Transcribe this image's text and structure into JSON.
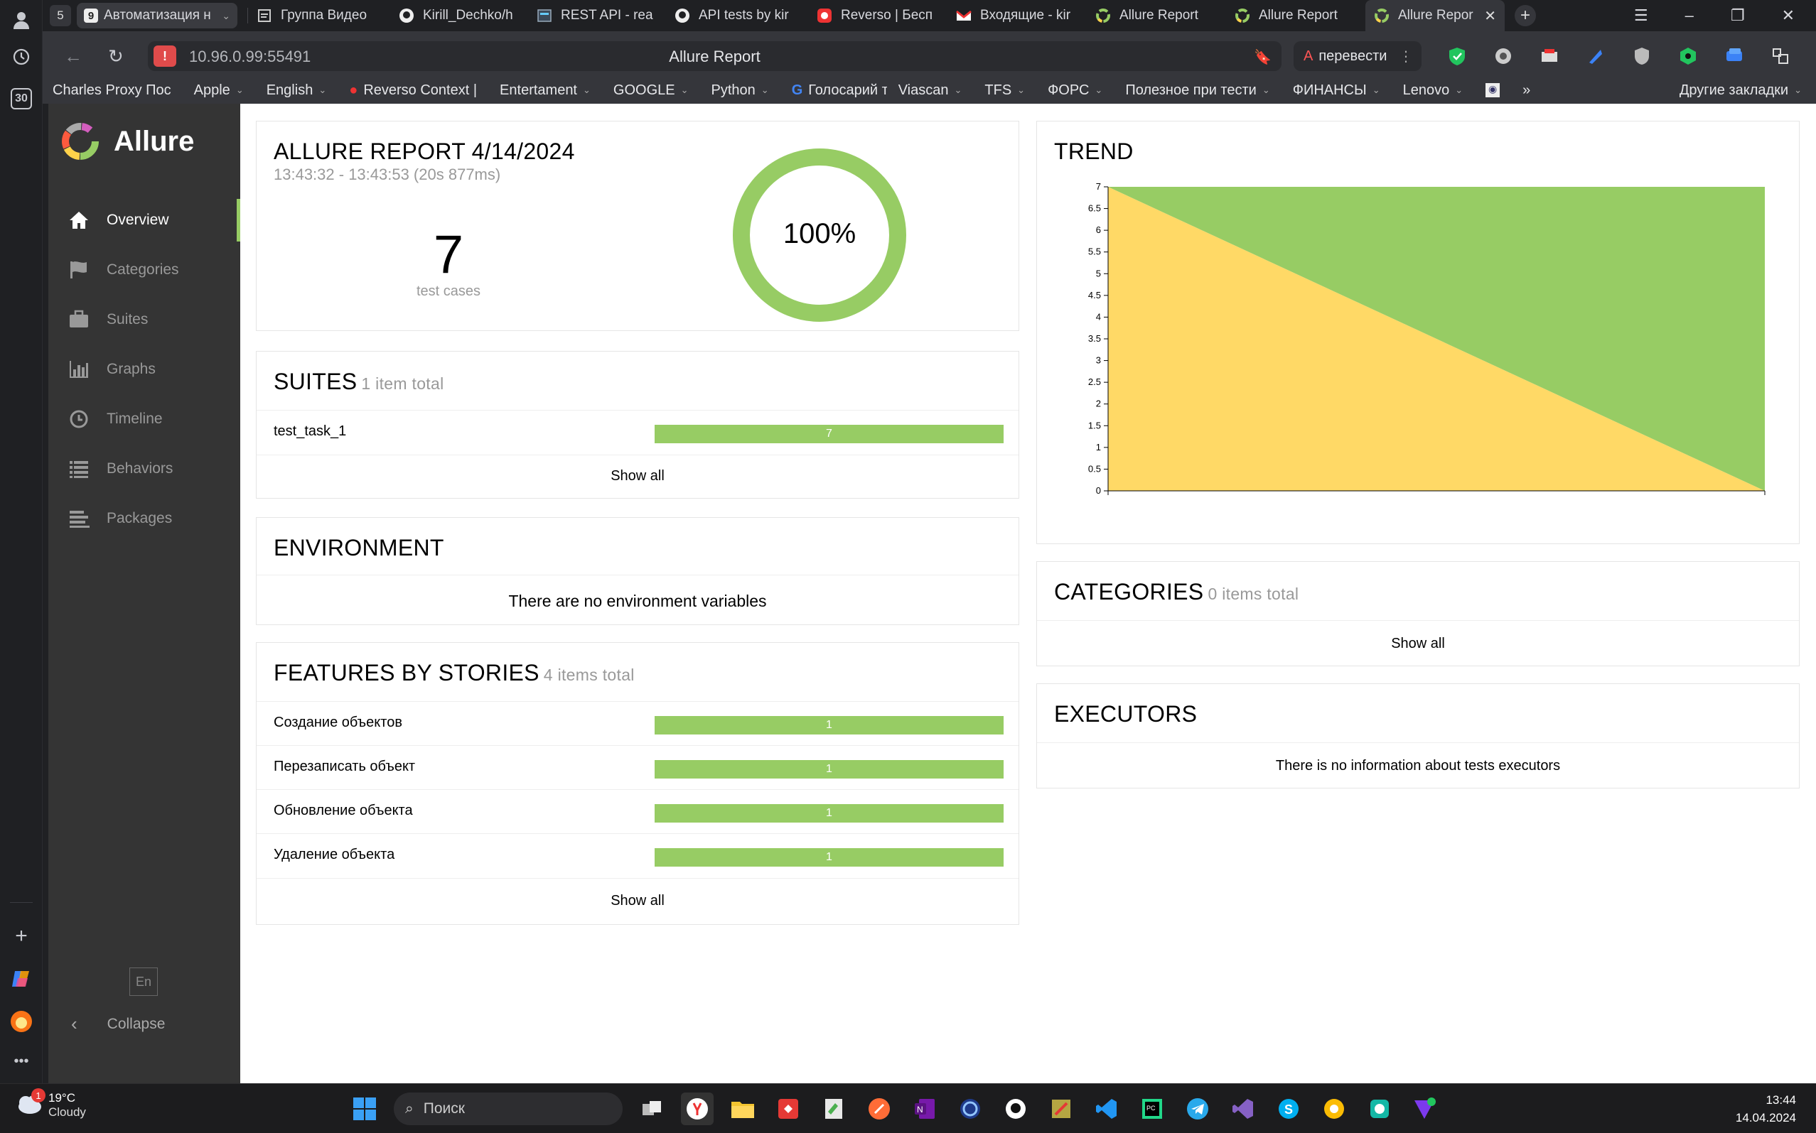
{
  "browser": {
    "tab_count": "5",
    "tabs": [
      {
        "label": "Автоматизация н",
        "group_num": "9",
        "icon": "tab-group-icon"
      },
      {
        "label": "Группа Видео",
        "icon": "page-icon"
      },
      {
        "label": "Kirill_Dechko/h",
        "icon": "github-icon"
      },
      {
        "label": "REST API - rea",
        "icon": "page-icon"
      },
      {
        "label": "API tests by kir",
        "icon": "github-icon"
      },
      {
        "label": "Reverso | Бесп",
        "icon": "reverso-icon"
      },
      {
        "label": "Входящие - kir",
        "icon": "gmail-icon"
      },
      {
        "label": "Allure Report",
        "icon": "allure-icon"
      },
      {
        "label": "Allure Report",
        "icon": "allure-icon"
      },
      {
        "label": "Allure Repor",
        "icon": "allure-icon"
      }
    ],
    "url": "10.96.0.99:55491",
    "page_title": "Allure Report",
    "translate_label": "перевести",
    "bookmarks": [
      {
        "label": "Charles Proxy Пос",
        "dropdown": false
      },
      {
        "label": "Apple",
        "dropdown": true
      },
      {
        "label": "English",
        "dropdown": true
      },
      {
        "label": "Reverso Context |",
        "dropdown": false
      },
      {
        "label": "Entertament",
        "dropdown": true
      },
      {
        "label": "GOOGLE",
        "dropdown": true
      },
      {
        "label": "Python",
        "dropdown": true
      },
      {
        "label": "Голосарий т",
        "dropdown": false
      },
      {
        "label": "Viascan",
        "dropdown": true
      },
      {
        "label": "TFS",
        "dropdown": true
      },
      {
        "label": "ФОРС",
        "dropdown": true
      },
      {
        "label": "Полезное при тести",
        "dropdown": true
      },
      {
        "label": "ФИНАНСЫ",
        "dropdown": true
      },
      {
        "label": "Lenovo",
        "dropdown": true
      }
    ],
    "other_bookmarks": "Другие закладки",
    "rail_badge": "30"
  },
  "allure": {
    "brand": "Allure",
    "nav": [
      {
        "label": "Overview",
        "icon": "home-icon",
        "active": true
      },
      {
        "label": "Categories",
        "icon": "flag-icon",
        "active": false
      },
      {
        "label": "Suites",
        "icon": "briefcase-icon",
        "active": false
      },
      {
        "label": "Graphs",
        "icon": "bar-chart-icon",
        "active": false
      },
      {
        "label": "Timeline",
        "icon": "clock-icon",
        "active": false
      },
      {
        "label": "Behaviors",
        "icon": "list-icon",
        "active": false
      },
      {
        "label": "Packages",
        "icon": "align-left-icon",
        "active": false
      }
    ],
    "lang": "En",
    "collapse": "Collapse",
    "summary": {
      "title": "ALLURE REPORT 4/14/2024",
      "time": "13:43:32 - 13:43:53 (20s 877ms)",
      "count": "7",
      "count_label": "test cases",
      "percent": "100%",
      "passed_fraction": 1.0
    },
    "suites": {
      "title": "SUITES",
      "count": "1 item total",
      "rows": [
        {
          "name": "test_task_1",
          "value": "7"
        }
      ],
      "show_all": "Show all"
    },
    "environment": {
      "title": "ENVIRONMENT",
      "empty": "There are no environment variables"
    },
    "features": {
      "title": "FEATURES BY STORIES",
      "count": "4 items total",
      "rows": [
        {
          "name": "Создание объектов",
          "value": "1"
        },
        {
          "name": "Перезаписать объект",
          "value": "1"
        },
        {
          "name": "Обновление объекта",
          "value": "1"
        },
        {
          "name": "Удаление объекта",
          "value": "1"
        }
      ],
      "show_all": "Show all"
    },
    "trend": {
      "title": "TREND"
    },
    "categories": {
      "title": "CATEGORIES",
      "count": "0 items total",
      "show_all": "Show all"
    },
    "executors": {
      "title": "EXECUTORS",
      "empty": "There is no information about tests executors"
    }
  },
  "chart_data": {
    "type": "area",
    "title": "TREND",
    "yticks": [
      "0",
      "0.5",
      "1",
      "1.5",
      "2",
      "2.5",
      "3",
      "3.5",
      "4",
      "4.5",
      "5",
      "5.5",
      "6",
      "6.5",
      "7"
    ],
    "ylim": [
      0,
      7
    ],
    "x": [
      0,
      1
    ],
    "series": [
      {
        "name": "",
        "color": "#ffd966",
        "values": [
          7,
          0
        ]
      },
      {
        "name": "",
        "color": "#97cc64",
        "values": [
          0,
          7
        ]
      }
    ]
  },
  "taskbar": {
    "weather_temp": "19°C",
    "weather_desc": "Cloudy",
    "weather_badge": "1",
    "search_placeholder": "Поиск",
    "time": "13:44",
    "date": "14.04.2024"
  },
  "colors": {
    "passed": "#97cc64",
    "broken": "#ffd966",
    "sidebar": "#343434"
  }
}
